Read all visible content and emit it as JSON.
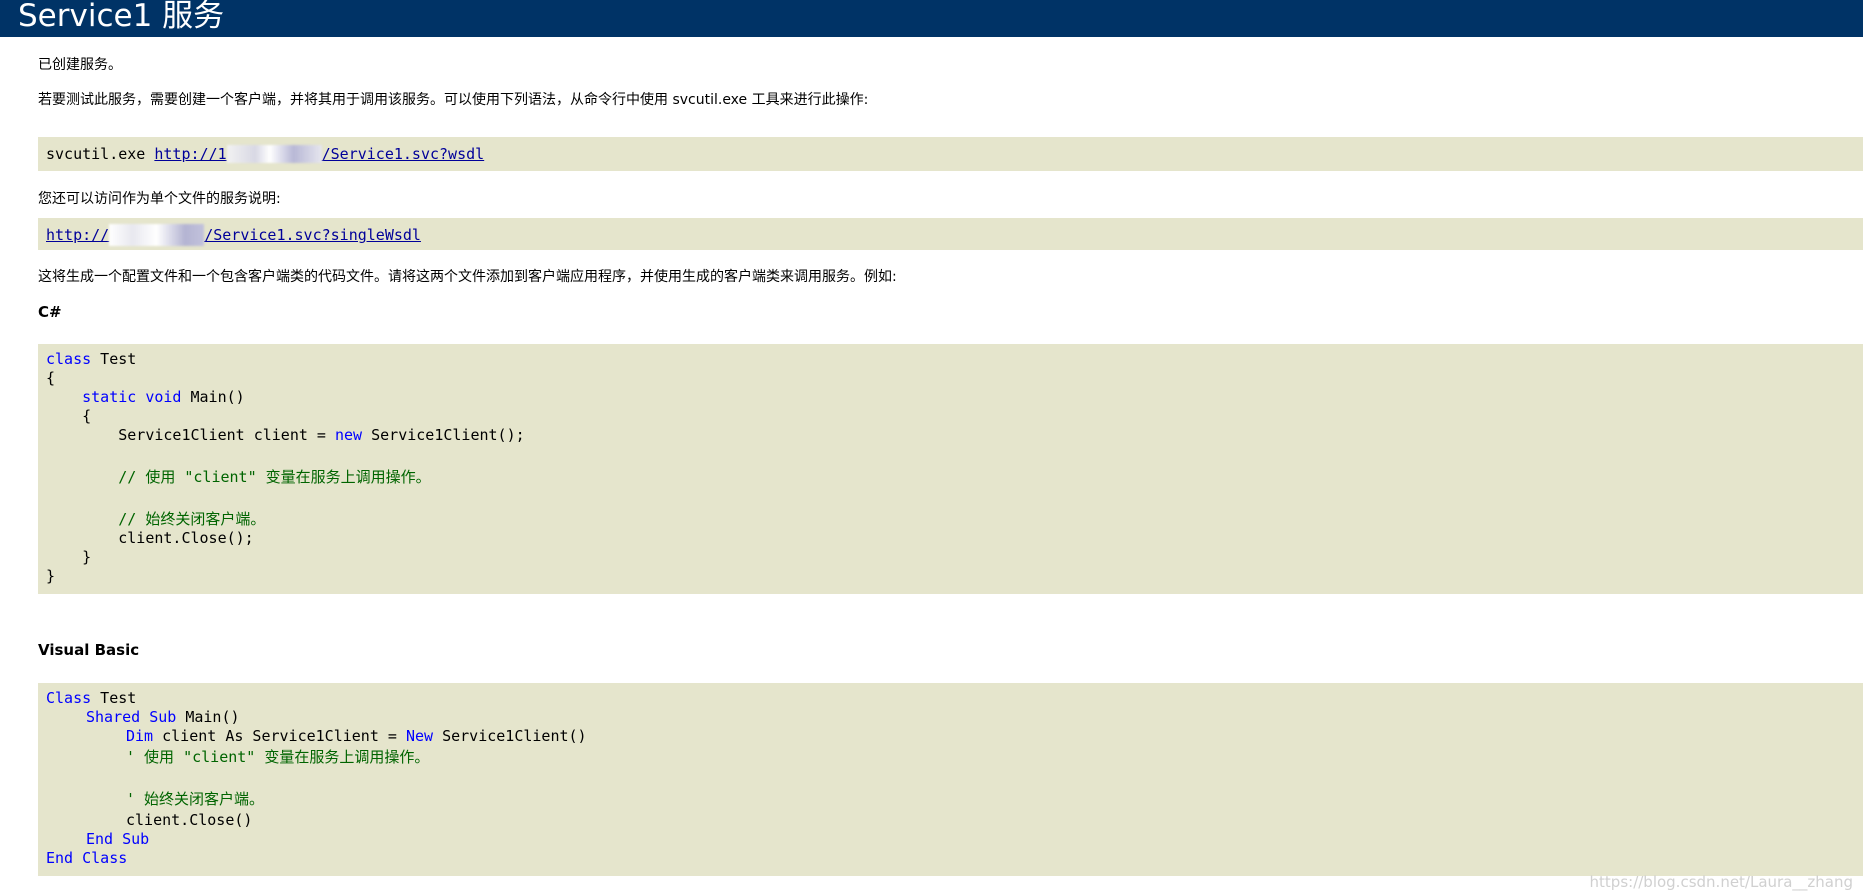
{
  "header": {
    "title": "Service1 服务",
    "background": "#003366"
  },
  "intro": {
    "created": "已创建服务。",
    "instructions": "若要测试此服务，需要创建一个客户端，并将其用于调用该服务。可以使用下列语法，从命令行中使用 svcutil.exe 工具来进行此操作:",
    "svcutil_cmd": "svcutil.exe",
    "wsdl_link_prefix": "http://1",
    "wsdl_link_suffix": "/Service1.svc?wsdl",
    "single_file_text": "您还可以访问作为单个文件的服务说明:",
    "single_wsdl_prefix": "http://",
    "single_wsdl_suffix": "/Service1.svc?singleWsdl",
    "generate_text": "这将生成一个配置文件和一个包含客户端类的代码文件。请将这两个文件添加到客户端应用程序，并使用生成的客户端类来调用服务。例如:"
  },
  "csharp": {
    "heading": "C#",
    "lines": {
      "l1_kw": "class",
      "l1_rest": " Test",
      "l2": "{",
      "l3_indent": "    ",
      "l3_kw1": "static",
      "l3_kw2": "void",
      "l3_rest": " Main()",
      "l4": "    {",
      "l5_a": "        Service1Client client = ",
      "l5_kw": "new",
      "l5_b": " Service1Client();",
      "l6_comment": "        // 使用 \"client\" 变量在服务上调用操作。",
      "l7_comment": "        // 始终关闭客户端。",
      "l8": "        client.Close();",
      "l9": "    }",
      "l10": "}"
    }
  },
  "vb": {
    "heading": "Visual Basic",
    "lines": {
      "l1_kw": "Class",
      "l1_rest": " Test",
      "l2_kw1": "Shared",
      "l2_kw2": "Sub",
      "l2_rest": " Main()",
      "l3_kw": "Dim",
      "l3_mid": " client As Service1Client = ",
      "l3_kw2": "New",
      "l3_rest": " Service1Client()",
      "l4_comment": "' 使用 \"client\" 变量在服务上调用操作。",
      "l5_comment": "' 始终关闭客户端。",
      "l6": "client.Close()",
      "l7_kw1": "End",
      "l7_kw2": "Sub",
      "l8_kw1": "End",
      "l8_kw2": "Class"
    }
  },
  "watermark": "https://blog.csdn.net/Laura__zhang",
  "colors": {
    "code_background": "#e5e5cc",
    "keyword": "#0000ff",
    "comment": "#006400",
    "link": "#000099"
  }
}
